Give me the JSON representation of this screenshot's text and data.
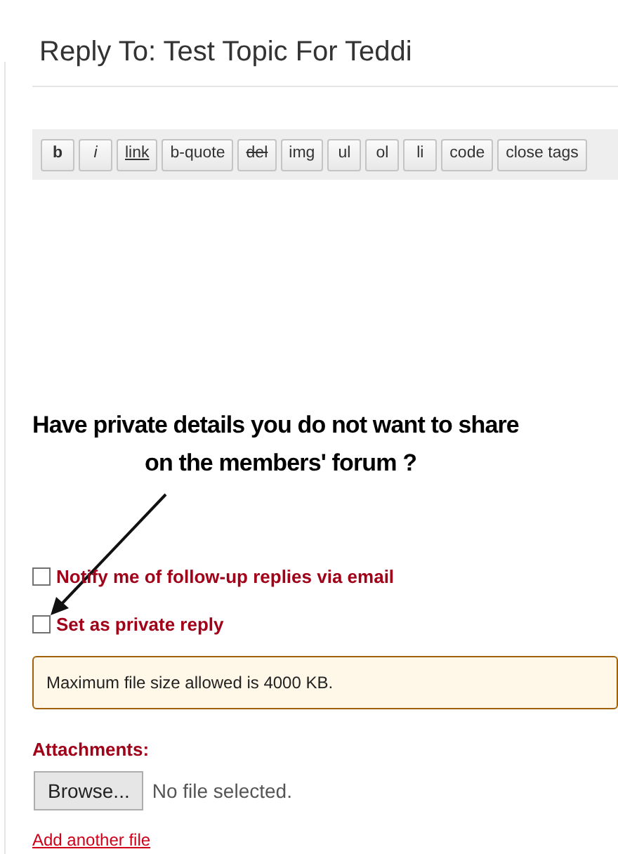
{
  "title": "Reply To: Test Topic For Teddi",
  "toolbar": [
    {
      "label": "b",
      "kind": "bold"
    },
    {
      "label": "i",
      "kind": "italic"
    },
    {
      "label": "link",
      "kind": "underline"
    },
    {
      "label": "b-quote",
      "kind": "plain"
    },
    {
      "label": "del",
      "kind": "strike"
    },
    {
      "label": "img",
      "kind": "plain"
    },
    {
      "label": "ul",
      "kind": "plain"
    },
    {
      "label": "ol",
      "kind": "plain"
    },
    {
      "label": "li",
      "kind": "plain"
    },
    {
      "label": "code",
      "kind": "plain"
    },
    {
      "label": "close tags",
      "kind": "plain"
    }
  ],
  "annotation": {
    "lines": [
      "Have private details you do not want to share",
      "on the members' forum ?"
    ]
  },
  "options": [
    {
      "label": "Notify me of follow-up replies via email",
      "checked": false
    },
    {
      "label": "Set as private reply",
      "checked": false
    }
  ],
  "notice": "Maximum file size allowed is 4000 KB.",
  "attachments": {
    "label": "Attachments:",
    "button": "Browse...",
    "status": "No file selected.",
    "link": "Add another file"
  }
}
